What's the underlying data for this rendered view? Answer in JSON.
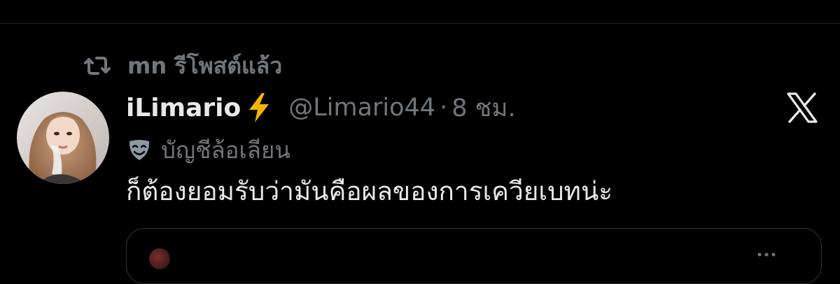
{
  "repost": {
    "icon": "repost-icon",
    "text": "mn รีโพสต์แล้ว"
  },
  "tweet": {
    "display_name": "iLimario",
    "badge_emoji": "lightning-bolt-icon",
    "handle": "@Limario44",
    "separator": "·",
    "time": "8 ชม.",
    "parody_icon": "mask-icon",
    "parody_label": "บัญชีล้อเลียน",
    "text": "ก็ต้องยอมรับว่ามันคือผลของการเควียเบทน่ะ"
  },
  "colors": {
    "background": "#000000",
    "text_primary": "#e7e9ea",
    "text_secondary": "#71767b",
    "border": "#2f3336",
    "bolt": "#f5b400"
  }
}
